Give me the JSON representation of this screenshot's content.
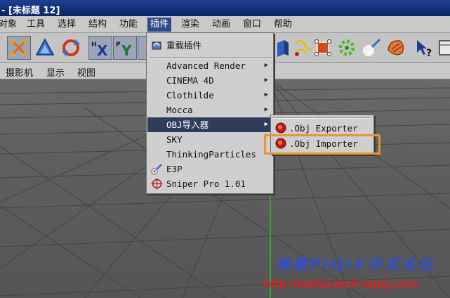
{
  "window": {
    "title": "- [未标题 12]"
  },
  "menubar": {
    "items": [
      "对象",
      "工具",
      "选择",
      "结构",
      "功能",
      "插件",
      "渲染",
      "动画",
      "窗口",
      "帮助"
    ],
    "active": "插件"
  },
  "toolbar": {
    "icons": [
      "move-icon",
      "scale-icon",
      "rotate-icon",
      "x-axis-icon",
      "y-axis-icon",
      "z-axis-icon",
      "cube-icon",
      "spline-icon",
      "deformer-box-icon",
      "gear-array-icon",
      "light-icon",
      "sphere-material-icon",
      "help-cursor-icon",
      "render-view-icon"
    ]
  },
  "viewmenu": {
    "items": [
      "摄影机",
      "显示",
      "视图"
    ]
  },
  "dropdown": {
    "items": [
      {
        "label": "重载插件",
        "icon": "reload-plugins-icon",
        "submenu": false
      },
      {
        "label": "Advanced Render",
        "submenu": true
      },
      {
        "label": "CINEMA 4D",
        "submenu": true
      },
      {
        "label": "Clothilde",
        "submenu": true
      },
      {
        "label": "Mocca",
        "submenu": true
      },
      {
        "label": "OBJ导入器",
        "submenu": true,
        "highlighted": true
      },
      {
        "label": "SKY",
        "submenu": false
      },
      {
        "label": "ThinkingParticles",
        "submenu": false
      },
      {
        "label": "E3P",
        "icon": "e3p-icon",
        "submenu": false
      },
      {
        "label": "Sniper Pro 1.01",
        "icon": "crosshair-icon",
        "submenu": false
      }
    ]
  },
  "submenu": {
    "items": [
      {
        "label": ".Obj Exporter",
        "icon": "obj-exporter-icon"
      },
      {
        "label": ".Obj Importer",
        "icon": "obj-importer-icon",
        "highlighted": true
      }
    ]
  },
  "watermark": {
    "text_cn": "美雅PiQiE中文论坛",
    "url": "http://meiya.tech.topzj.com"
  },
  "colors": {
    "title_bar": "#0a2466",
    "menu_active": "#2e4a8a",
    "highlight_outline": "#e8962a",
    "watermark_blue": "#2c4fd8",
    "watermark_red": "#e0201c",
    "y_axis_green": "#2fbf2f"
  }
}
